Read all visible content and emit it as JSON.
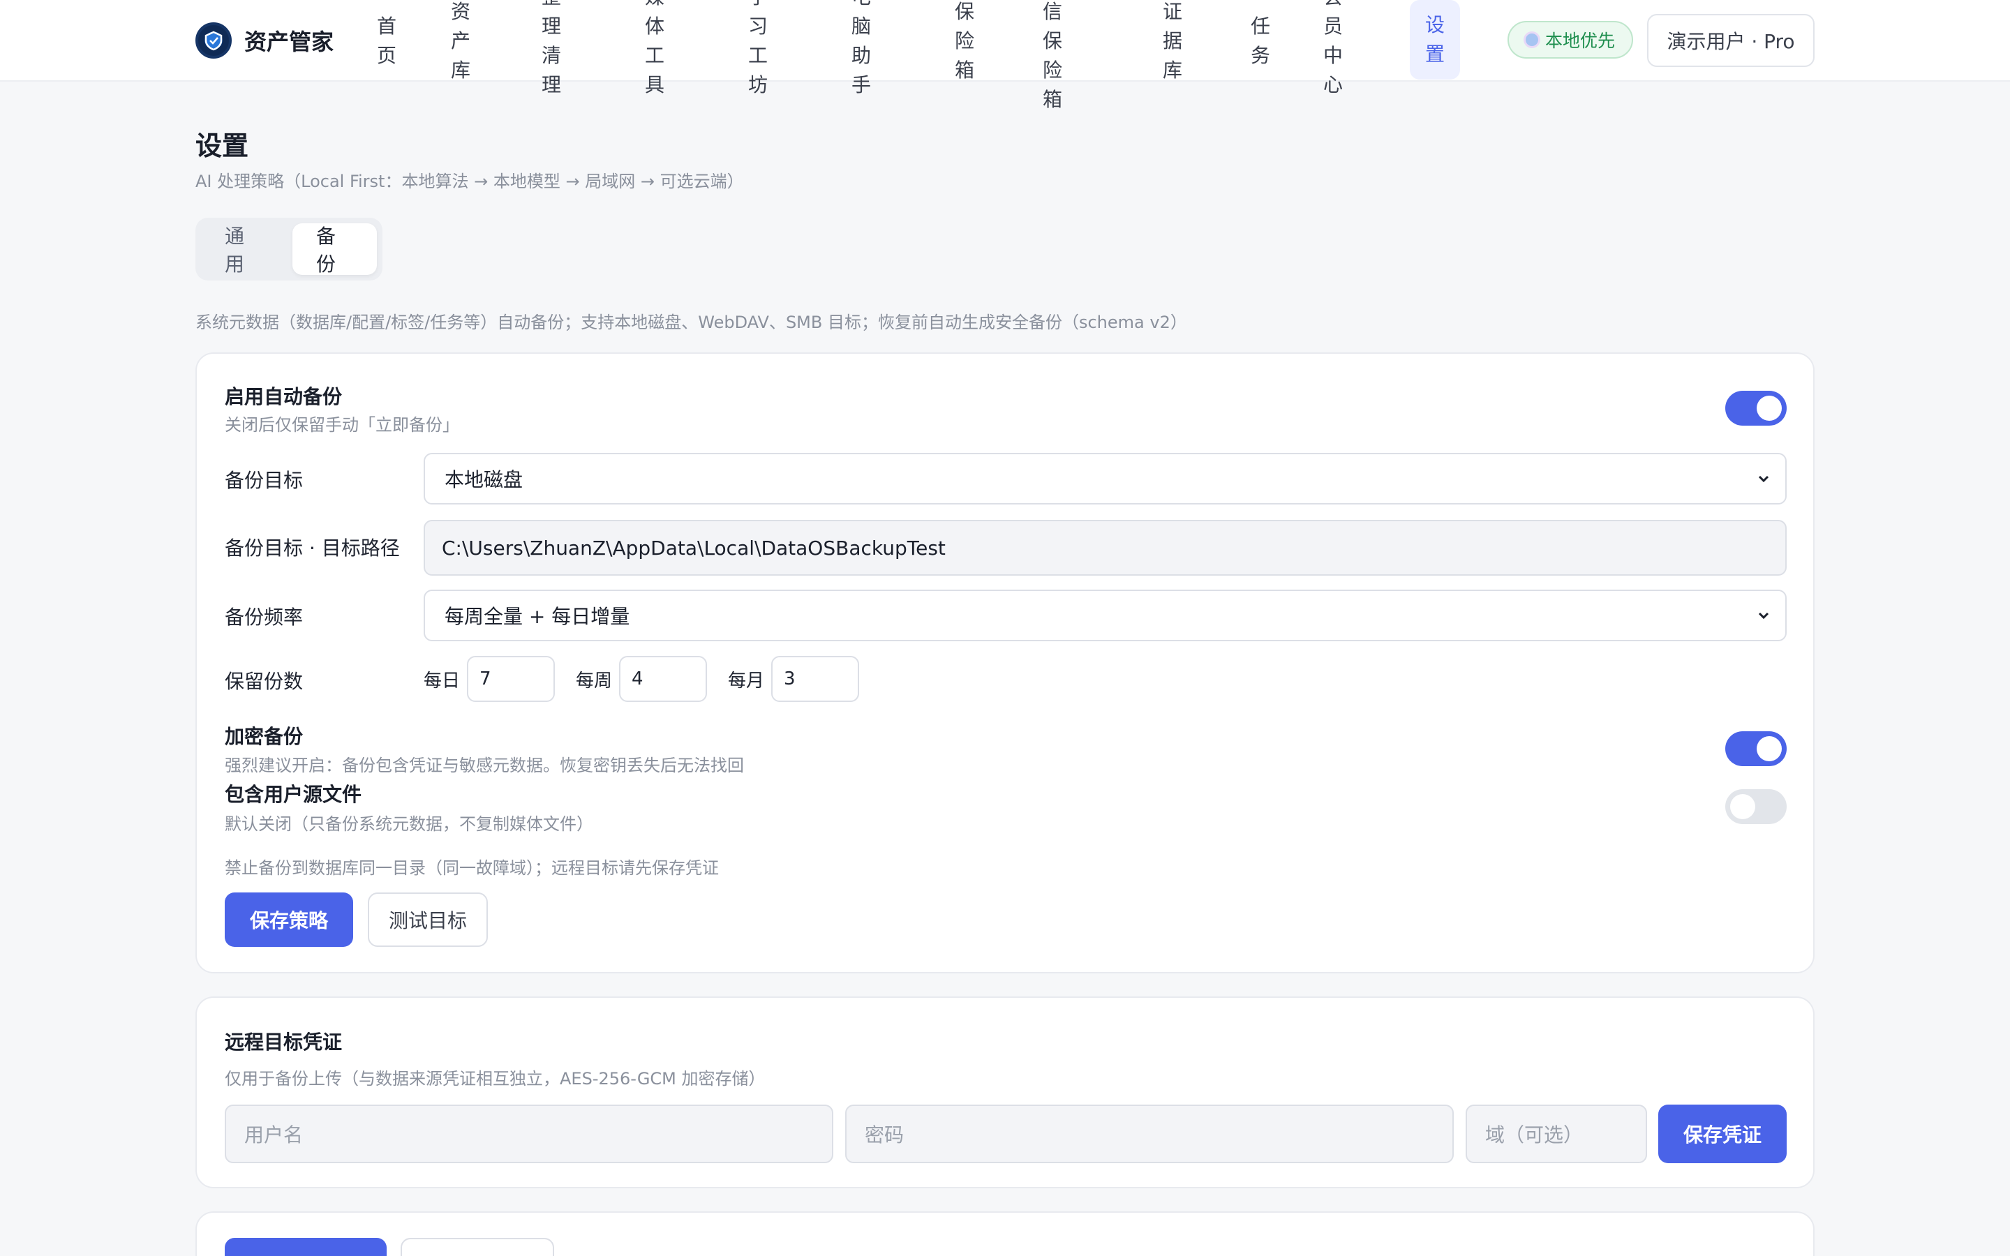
{
  "app": {
    "brand_name": "资产管家",
    "local_badge": "本地优先",
    "user": "演示用户 · Pro"
  },
  "nav": [
    {
      "line1": "首",
      "line2": "页"
    },
    {
      "line1": "资产",
      "line2": "库"
    },
    {
      "line1": "整理清",
      "line2": "理"
    },
    {
      "line1": "媒体工",
      "line2": "具"
    },
    {
      "line1": "学习工",
      "line2": "坊"
    },
    {
      "line1": "电脑助",
      "line2": "手"
    },
    {
      "line1": "保险",
      "line2": "箱"
    },
    {
      "line1": "微信保",
      "line2": "险箱"
    },
    {
      "line1": "证据",
      "line2": "库"
    },
    {
      "line1": "任",
      "line2": "务"
    },
    {
      "line1": "会员中",
      "line2": "心"
    },
    {
      "line1": "设",
      "line2": "置"
    }
  ],
  "header": {
    "title": "设置",
    "subtitle": "AI 处理策略（Local First：本地算法 → 本地模型 → 局域网 → 可选云端）"
  },
  "tabs": [
    {
      "label": "通用"
    },
    {
      "label": "备份"
    }
  ],
  "section_desc": "系统元数据（数据库/配置/标签/任务等）自动备份；支持本地磁盘、WebDAV、SMB 目标；恢复前自动生成安全备份（schema v2）",
  "backup": {
    "auto_title": "启用自动备份",
    "auto_hint": "关闭后仅保留手动「立即备份」",
    "auto_enabled": true,
    "target_label": "备份目标",
    "target_value": "本地磁盘",
    "path_label": "备份目标 · 目标路径",
    "path_value": "C:\\Users\\ZhuanZ\\AppData\\Local\\DataOSBackupTest",
    "freq_label": "备份频率",
    "freq_value": "每周全量 + 每日增量",
    "keep_label": "保留份数",
    "keep_daily_label": "每日",
    "keep_daily": "7",
    "keep_weekly_label": "每周",
    "keep_weekly": "4",
    "keep_monthly_label": "每月",
    "keep_monthly": "3",
    "encrypt_title": "加密备份",
    "encrypt_hint": "强烈建议开启：备份包含凭证与敏感元数据。恢复密钥丢失后无法找回",
    "encrypt_enabled": true,
    "include_title": "包含用户源文件",
    "include_hint": "默认关闭（只备份系统元数据，不复制媒体文件）",
    "include_enabled": false,
    "warning": "禁止备份到数据库同一目录（同一故障域）；远程目标请先保存凭证",
    "save_button": "保存策略",
    "test_button": "测试目标"
  },
  "credentials": {
    "title": "远程目标凭证",
    "hint": "仅用于备份上传（与数据来源凭证相互独立，AES-256-GCM 加密存储）",
    "username_placeholder": "用户名",
    "password_placeholder": "密码",
    "domain_placeholder": "域（可选）",
    "save_button": "保存凭证"
  },
  "colors": {
    "accent": "#4a63e8",
    "badge_green": "#1e8e4e"
  }
}
